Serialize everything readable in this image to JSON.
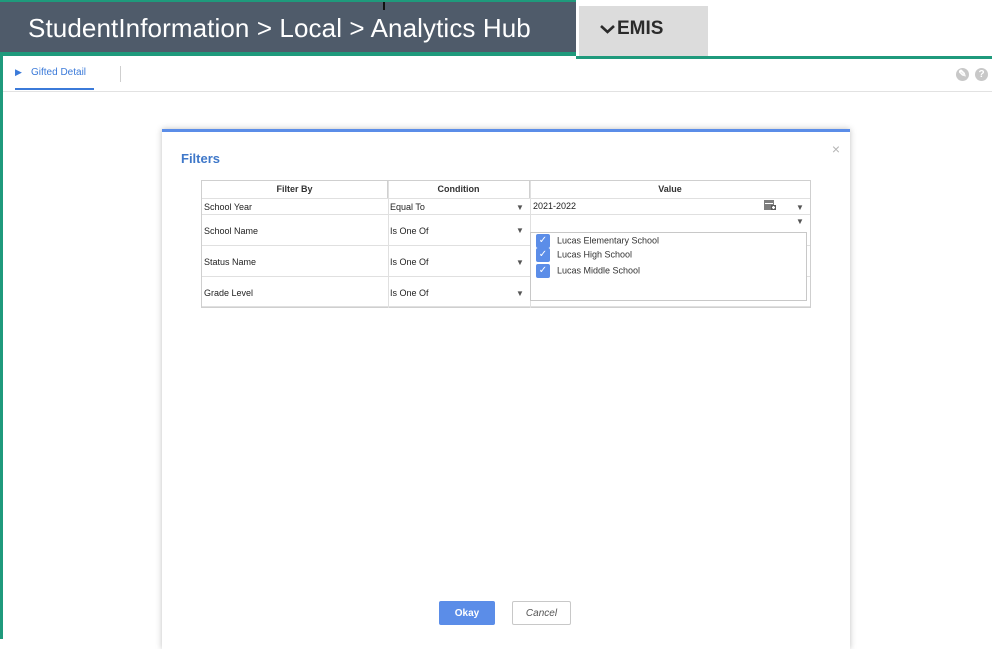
{
  "header": {
    "breadcrumb": "StudentInformation > Local > Analytics Hub",
    "module_tab": "EMIS",
    "module_chevron": "✓"
  },
  "tabs": [
    {
      "label": "Gifted Detail",
      "icon": "play-icon",
      "active": true
    }
  ],
  "toolbar_icons": [
    "wrench-icon",
    "help-icon"
  ],
  "dialog": {
    "title": "Filters",
    "close_glyph": "×",
    "columns": [
      "Filter By",
      "Condition",
      "Value"
    ],
    "rows": [
      {
        "filter_by": "School Year",
        "condition": "Equal To",
        "value": "2021-2022"
      },
      {
        "filter_by": "School Name",
        "condition": "Is One Of",
        "value": ""
      },
      {
        "filter_by": "Status Name",
        "condition": "Is One Of",
        "value": ""
      },
      {
        "filter_by": "Grade Level",
        "condition": "Is One Of",
        "value": ""
      }
    ],
    "value_options": [
      {
        "label": "Lucas Elementary School",
        "checked": true
      },
      {
        "label": "Lucas High School",
        "checked": true
      },
      {
        "label": "Lucas Middle School",
        "checked": true
      }
    ],
    "okay_label": "Okay",
    "cancel_label": "Cancel"
  },
  "colors": {
    "accent": "#5b8de8",
    "header_bg": "#4f5b6a",
    "green_border": "#1f9a7c",
    "title_blue": "#3f78c9"
  }
}
